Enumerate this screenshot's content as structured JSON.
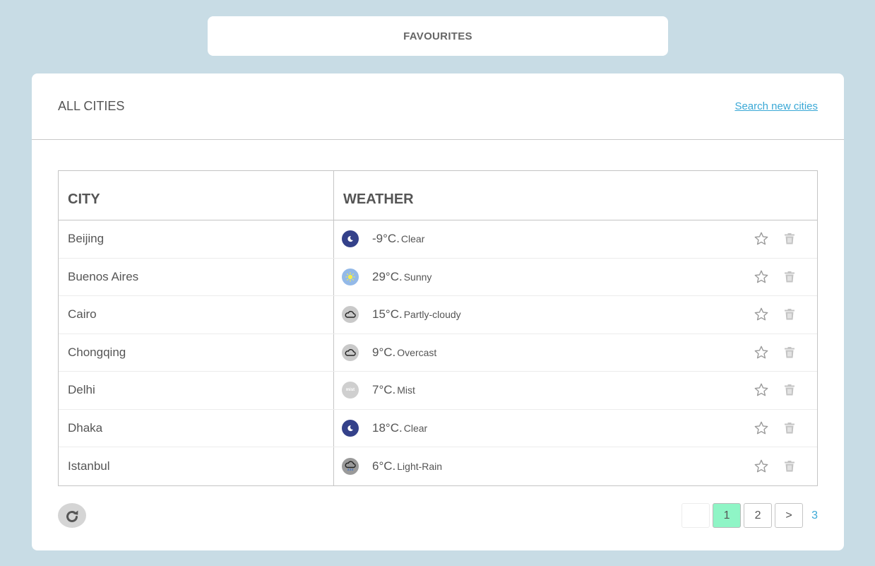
{
  "favourites": {
    "label": "FAVOURITES"
  },
  "header": {
    "title": "ALL CITIES",
    "search_link": "Search new cities"
  },
  "table": {
    "columns": [
      "CITY",
      "WEATHER"
    ],
    "rows": [
      {
        "city": "Beijing",
        "temp": "-9°C.",
        "condition": "Clear",
        "icon": "moon-icon"
      },
      {
        "city": "Buenos Aires",
        "temp": "29°C.",
        "condition": "Sunny",
        "icon": "sun-icon"
      },
      {
        "city": "Cairo",
        "temp": "15°C.",
        "condition": "Partly-cloudy",
        "icon": "cloud-icon"
      },
      {
        "city": "Chongqing",
        "temp": "9°C.",
        "condition": "Overcast",
        "icon": "cloud-icon"
      },
      {
        "city": "Delhi",
        "temp": "7°C.",
        "condition": "Mist",
        "icon": "mist-icon"
      },
      {
        "city": "Dhaka",
        "temp": "18°C.",
        "condition": "Clear",
        "icon": "moon-icon"
      },
      {
        "city": "Istanbul",
        "temp": "6°C.",
        "condition": "Light-Rain",
        "icon": "rain-cloud-icon"
      }
    ]
  },
  "pagination": {
    "pages": [
      "1",
      "2"
    ],
    "next": ">",
    "last": "3",
    "active": "1"
  },
  "colors": {
    "background": "#c8dce5",
    "link": "#3aa8d6",
    "active_page": "#8ff5c6",
    "moon_bg": "#34418a",
    "sun_bg": "#93b9e8"
  }
}
